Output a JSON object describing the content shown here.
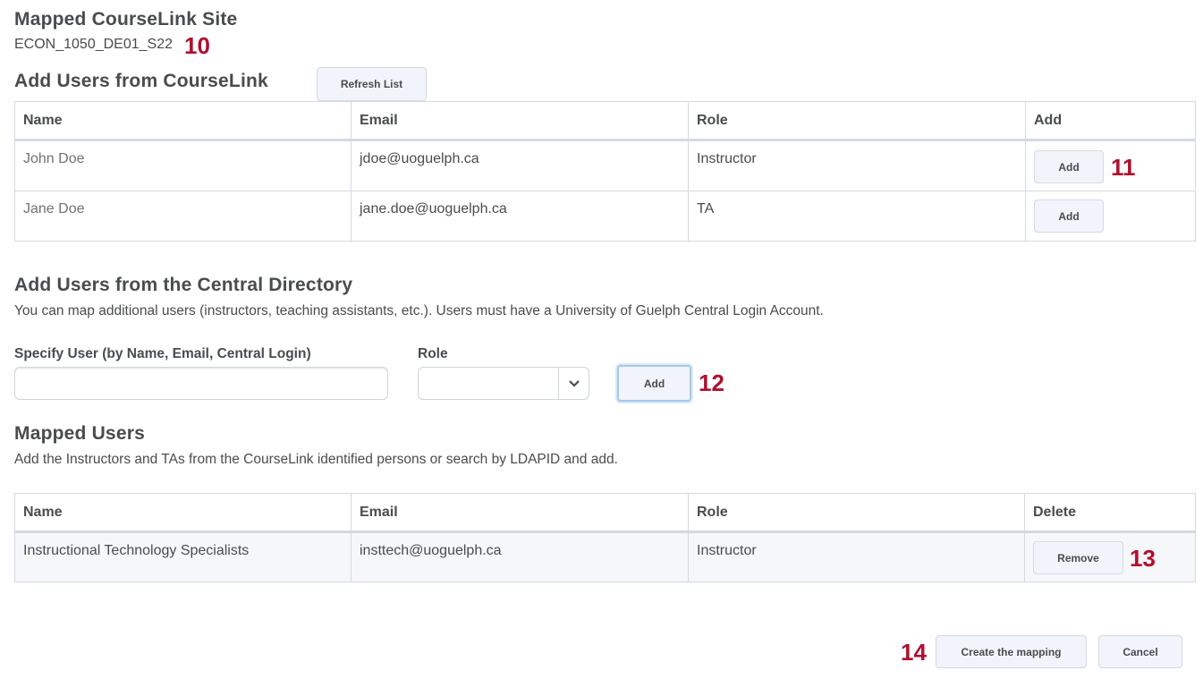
{
  "mapped_site": {
    "heading": "Mapped CourseLink Site",
    "course_code": "ECON_1050_DE01_S22",
    "callout": "10"
  },
  "courselink_users": {
    "heading": "Add Users from CourseLink",
    "refresh_label": "Refresh List",
    "columns": [
      "Name",
      "Email",
      "Role",
      "Add"
    ],
    "rows": [
      {
        "name": "John Doe",
        "email": "jdoe@uoguelph.ca",
        "role": "Instructor",
        "action": "Add",
        "callout": "11"
      },
      {
        "name": "Jane Doe",
        "email": "jane.doe@uoguelph.ca",
        "role": "TA",
        "action": "Add",
        "callout": ""
      }
    ]
  },
  "central_directory": {
    "heading": "Add Users from the Central Directory",
    "description": "You can map additional users (instructors, teaching assistants, etc.). Users must have a University of Guelph Central Login Account.",
    "user_label": "Specify User (by Name, Email, Central Login)",
    "user_value": "",
    "role_label": "Role",
    "role_value": "",
    "add_label": "Add",
    "callout": "12"
  },
  "mapped_users": {
    "heading": "Mapped Users",
    "description": "Add the Instructors and TAs from the CourseLink identified persons or search by LDAPID and add.",
    "columns": [
      "Name",
      "Email",
      "Role",
      "Delete"
    ],
    "rows": [
      {
        "name": "Instructional Technology Specialists",
        "email": "insttech@uoguelph.ca",
        "role": "Instructor",
        "action": "Remove",
        "callout": "13"
      }
    ]
  },
  "footer": {
    "create_label": "Create the mapping",
    "cancel_label": "Cancel",
    "callout": "14"
  },
  "colors": {
    "callout": "#b0102f",
    "text": "#494c4e",
    "button_bg": "#f1f5fb",
    "border": "#d3d9e3"
  }
}
